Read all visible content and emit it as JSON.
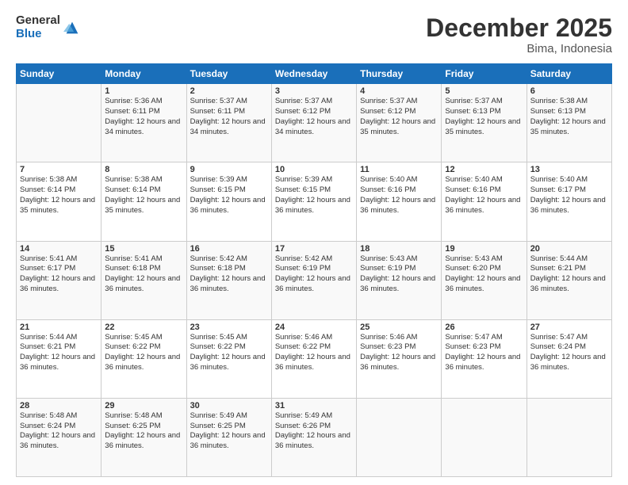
{
  "header": {
    "logo_general": "General",
    "logo_blue": "Blue",
    "month_title": "December 2025",
    "location": "Bima, Indonesia"
  },
  "days_of_week": [
    "Sunday",
    "Monday",
    "Tuesday",
    "Wednesday",
    "Thursday",
    "Friday",
    "Saturday"
  ],
  "weeks": [
    [
      {
        "day": "",
        "info": ""
      },
      {
        "day": "1",
        "info": "Sunrise: 5:36 AM\nSunset: 6:11 PM\nDaylight: 12 hours and 34 minutes."
      },
      {
        "day": "2",
        "info": "Sunrise: 5:37 AM\nSunset: 6:11 PM\nDaylight: 12 hours and 34 minutes."
      },
      {
        "day": "3",
        "info": "Sunrise: 5:37 AM\nSunset: 6:12 PM\nDaylight: 12 hours and 34 minutes."
      },
      {
        "day": "4",
        "info": "Sunrise: 5:37 AM\nSunset: 6:12 PM\nDaylight: 12 hours and 35 minutes."
      },
      {
        "day": "5",
        "info": "Sunrise: 5:37 AM\nSunset: 6:13 PM\nDaylight: 12 hours and 35 minutes."
      },
      {
        "day": "6",
        "info": "Sunrise: 5:38 AM\nSunset: 6:13 PM\nDaylight: 12 hours and 35 minutes."
      }
    ],
    [
      {
        "day": "7",
        "info": "Sunrise: 5:38 AM\nSunset: 6:14 PM\nDaylight: 12 hours and 35 minutes."
      },
      {
        "day": "8",
        "info": "Sunrise: 5:38 AM\nSunset: 6:14 PM\nDaylight: 12 hours and 35 minutes."
      },
      {
        "day": "9",
        "info": "Sunrise: 5:39 AM\nSunset: 6:15 PM\nDaylight: 12 hours and 36 minutes."
      },
      {
        "day": "10",
        "info": "Sunrise: 5:39 AM\nSunset: 6:15 PM\nDaylight: 12 hours and 36 minutes."
      },
      {
        "day": "11",
        "info": "Sunrise: 5:40 AM\nSunset: 6:16 PM\nDaylight: 12 hours and 36 minutes."
      },
      {
        "day": "12",
        "info": "Sunrise: 5:40 AM\nSunset: 6:16 PM\nDaylight: 12 hours and 36 minutes."
      },
      {
        "day": "13",
        "info": "Sunrise: 5:40 AM\nSunset: 6:17 PM\nDaylight: 12 hours and 36 minutes."
      }
    ],
    [
      {
        "day": "14",
        "info": "Sunrise: 5:41 AM\nSunset: 6:17 PM\nDaylight: 12 hours and 36 minutes."
      },
      {
        "day": "15",
        "info": "Sunrise: 5:41 AM\nSunset: 6:18 PM\nDaylight: 12 hours and 36 minutes."
      },
      {
        "day": "16",
        "info": "Sunrise: 5:42 AM\nSunset: 6:18 PM\nDaylight: 12 hours and 36 minutes."
      },
      {
        "day": "17",
        "info": "Sunrise: 5:42 AM\nSunset: 6:19 PM\nDaylight: 12 hours and 36 minutes."
      },
      {
        "day": "18",
        "info": "Sunrise: 5:43 AM\nSunset: 6:19 PM\nDaylight: 12 hours and 36 minutes."
      },
      {
        "day": "19",
        "info": "Sunrise: 5:43 AM\nSunset: 6:20 PM\nDaylight: 12 hours and 36 minutes."
      },
      {
        "day": "20",
        "info": "Sunrise: 5:44 AM\nSunset: 6:21 PM\nDaylight: 12 hours and 36 minutes."
      }
    ],
    [
      {
        "day": "21",
        "info": "Sunrise: 5:44 AM\nSunset: 6:21 PM\nDaylight: 12 hours and 36 minutes."
      },
      {
        "day": "22",
        "info": "Sunrise: 5:45 AM\nSunset: 6:22 PM\nDaylight: 12 hours and 36 minutes."
      },
      {
        "day": "23",
        "info": "Sunrise: 5:45 AM\nSunset: 6:22 PM\nDaylight: 12 hours and 36 minutes."
      },
      {
        "day": "24",
        "info": "Sunrise: 5:46 AM\nSunset: 6:22 PM\nDaylight: 12 hours and 36 minutes."
      },
      {
        "day": "25",
        "info": "Sunrise: 5:46 AM\nSunset: 6:23 PM\nDaylight: 12 hours and 36 minutes."
      },
      {
        "day": "26",
        "info": "Sunrise: 5:47 AM\nSunset: 6:23 PM\nDaylight: 12 hours and 36 minutes."
      },
      {
        "day": "27",
        "info": "Sunrise: 5:47 AM\nSunset: 6:24 PM\nDaylight: 12 hours and 36 minutes."
      }
    ],
    [
      {
        "day": "28",
        "info": "Sunrise: 5:48 AM\nSunset: 6:24 PM\nDaylight: 12 hours and 36 minutes."
      },
      {
        "day": "29",
        "info": "Sunrise: 5:48 AM\nSunset: 6:25 PM\nDaylight: 12 hours and 36 minutes."
      },
      {
        "day": "30",
        "info": "Sunrise: 5:49 AM\nSunset: 6:25 PM\nDaylight: 12 hours and 36 minutes."
      },
      {
        "day": "31",
        "info": "Sunrise: 5:49 AM\nSunset: 6:26 PM\nDaylight: 12 hours and 36 minutes."
      },
      {
        "day": "",
        "info": ""
      },
      {
        "day": "",
        "info": ""
      },
      {
        "day": "",
        "info": ""
      }
    ]
  ]
}
